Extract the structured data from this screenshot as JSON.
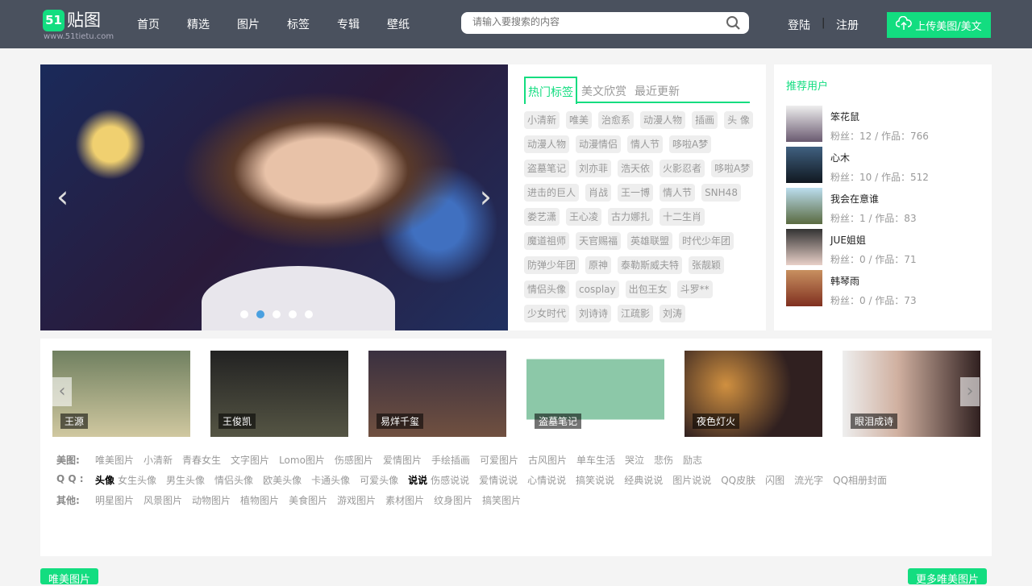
{
  "header": {
    "logo_badge": "51",
    "logo_name": "贴图",
    "logo_url": "www.51tietu.com",
    "nav": [
      "首页",
      "精选",
      "图片",
      "标签",
      "专辑",
      "壁纸"
    ],
    "search_placeholder": "请输入要搜索的内容",
    "login": "登陆",
    "separator": "|",
    "register": "注册",
    "upload": "上传美图/美文"
  },
  "slider": {
    "dots": 5,
    "active_dot": 2
  },
  "tag_panel": {
    "tabs": [
      "热门标签",
      "美文欣赏",
      "最近更新"
    ],
    "active_tab": 0,
    "tags": [
      "小清新",
      "唯美",
      "治愈系",
      "动漫人物",
      "插画",
      "头 像",
      "动漫人物",
      "动漫情侣",
      "情人节",
      "哆啦A梦",
      "盗墓笔记",
      "刘亦菲",
      "浩天依",
      "火影忍者",
      "哆啦A梦",
      "进击的巨人",
      "肖战",
      "王一博",
      "情人节",
      "SNH48",
      "娄艺潇",
      "王心凌",
      "古力娜扎",
      "十二生肖",
      "魔道祖师",
      "天官赐福",
      "英雄联盟",
      "时代少年团",
      "防弹少年团",
      "原神",
      "泰勒斯威夫特",
      "张靓颖",
      "情侣头像",
      "cosplay",
      "出包王女",
      "斗罗**",
      "少女时代",
      "刘诗诗",
      "江疏影",
      "刘涛"
    ]
  },
  "users": {
    "title": "推荐用户",
    "list": [
      {
        "name": "笨花鼠",
        "stats": "粉丝：12 / 作品：766"
      },
      {
        "name": "心木",
        "stats": "粉丝：10 / 作品：512"
      },
      {
        "name": "我会在意谁",
        "stats": "粉丝：1 / 作品：83"
      },
      {
        "name": "JUE姐姐",
        "stats": "粉丝：0 / 作品：71"
      },
      {
        "name": "韩琴雨",
        "stats": "粉丝：0 / 作品：73"
      }
    ]
  },
  "strip": {
    "items": [
      "王源",
      "王俊凯",
      "易烊千玺",
      "盗墓笔记",
      "夜色灯火",
      "眼泪成诗"
    ]
  },
  "categories": [
    {
      "label": "美图:",
      "links": [
        "唯美图片",
        "小清新",
        "青春女生",
        "文字图片",
        "Lomo图片",
        "伤感图片",
        "爱情图片",
        "手绘插画",
        "可爱图片",
        "古风图片",
        "单车生活",
        "哭泣",
        "悲伤",
        "励志"
      ]
    },
    {
      "label": "Q Q :",
      "links": [
        "头像",
        "女生头像",
        "男生头像",
        "情侣头像",
        "欧美头像",
        "卡通头像",
        "可爱头像",
        "说说",
        "伤感说说",
        "爱情说说",
        "心情说说",
        "搞笑说说",
        "经典说说",
        "图片说说",
        "QQ皮肤",
        "闪图",
        "流光字",
        "QQ相册封面"
      ]
    },
    {
      "label": "其他:",
      "links": [
        "明星图片",
        "风景图片",
        "动物图片",
        "植物图片",
        "美食图片",
        "游戏图片",
        "素材图片",
        "纹身图片",
        "搞笑图片"
      ]
    }
  ],
  "bottom": {
    "left": "唯美图片",
    "right": "更多唯美图片"
  }
}
